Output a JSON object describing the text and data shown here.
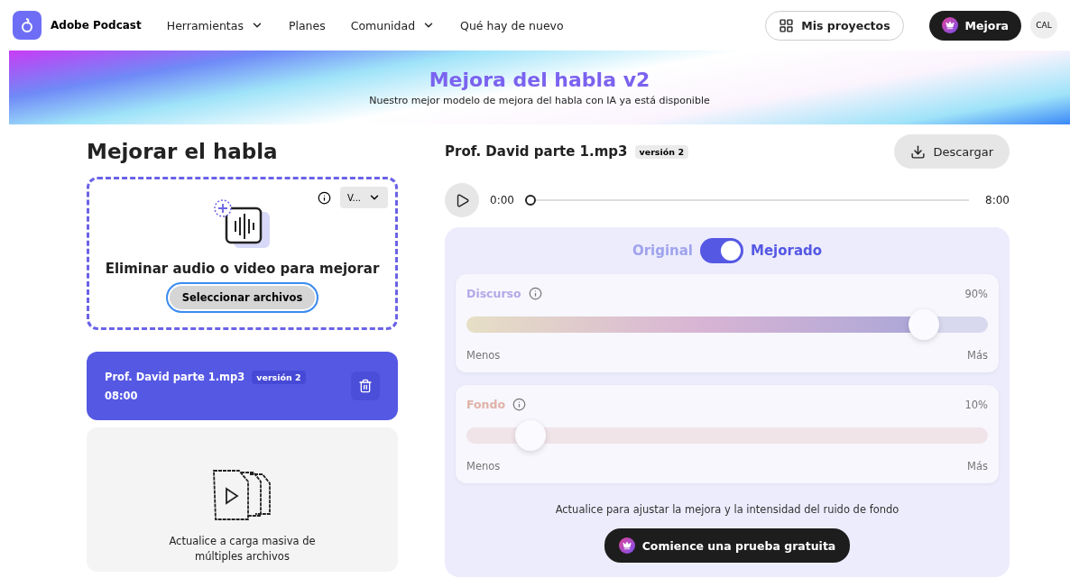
{
  "header": {
    "brand": "Adobe Podcast",
    "nav": [
      {
        "label": "Herramientas",
        "dropdown": true
      },
      {
        "label": "Planes",
        "dropdown": false
      },
      {
        "label": "Comunidad",
        "dropdown": true
      },
      {
        "label": "Qué hay de nuevo",
        "dropdown": false
      }
    ],
    "projects_button": "Mis proyectos",
    "upgrade_button": "Mejora",
    "avatar": "CAL"
  },
  "banner": {
    "title": "Mejora del habla v2",
    "subtitle": "Nuestro mejor modelo de mejora del habla con IA ya está disponible"
  },
  "left": {
    "title": "Mejorar el habla",
    "dropzone": {
      "version_select": "V...",
      "text": "Eliminar audio o video para mejorar",
      "button": "Seleccionar archivos"
    },
    "files": [
      {
        "name": "Prof. David parte 1.mp3",
        "badge": "versión 2",
        "duration": "08:00",
        "selected": true
      }
    ],
    "bulk": {
      "text": "Actualice a carga masiva de múltiples archivos"
    }
  },
  "right": {
    "file_name": "Prof. David parte 1.mp3",
    "badge": "versión 2",
    "download_button": "Descargar",
    "player": {
      "current": "0:00",
      "total": "8:00",
      "level": 0
    },
    "toggle": {
      "left_label": "Original",
      "right_label": "Mejorado",
      "on": true
    },
    "sliders": [
      {
        "label": "Discurso",
        "value": "90%",
        "level": 0.9,
        "min_label": "Menos",
        "max_label": "Más",
        "kind": "speech"
      },
      {
        "label": "Fondo",
        "value": "10%",
        "level": 0.1,
        "min_label": "Menos",
        "max_label": "Más",
        "kind": "background"
      }
    ],
    "upgrade_note": "Actualice para ajustar la mejora y la intensidad del ruido de fondo",
    "trial_button": "Comience una prueba gratuita"
  }
}
